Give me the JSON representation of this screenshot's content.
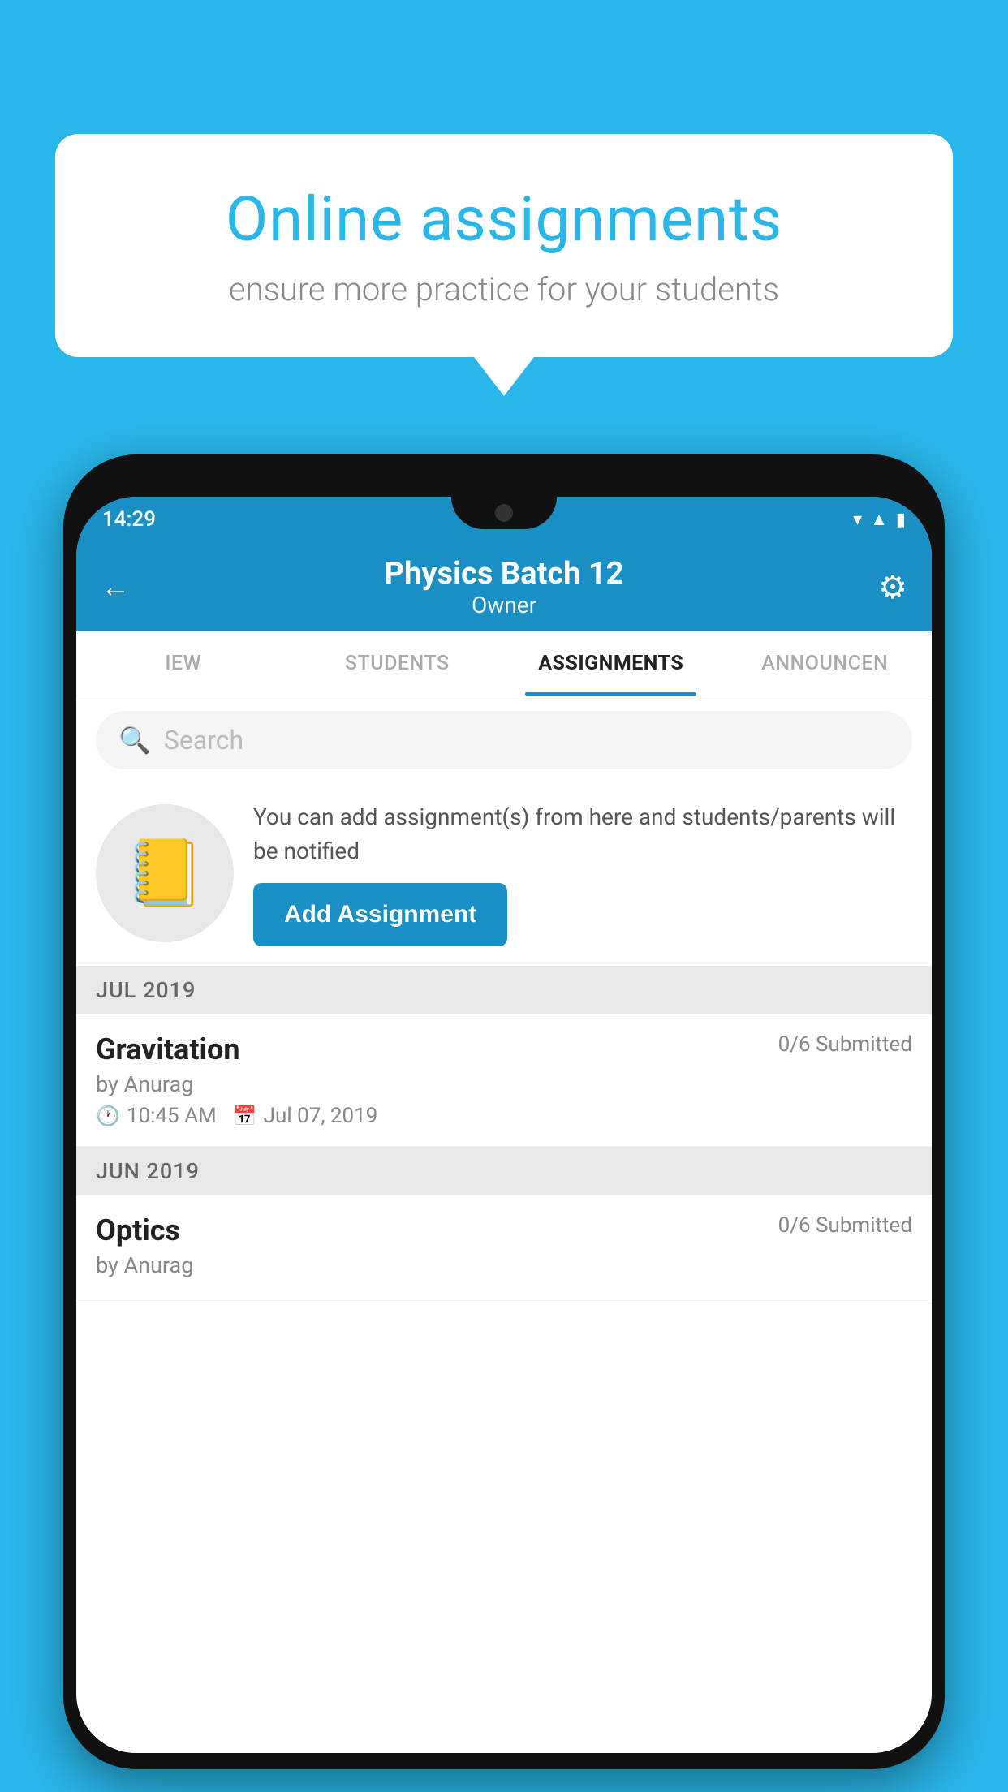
{
  "background_color": "#29b6e8",
  "speech_bubble": {
    "title": "Online assignments",
    "subtitle": "ensure more practice for your students"
  },
  "status_bar": {
    "time": "14:29",
    "icons": [
      "wifi",
      "signal",
      "battery"
    ]
  },
  "top_bar": {
    "title": "Physics Batch 12",
    "subtitle": "Owner",
    "back_label": "←",
    "gear_label": "⚙"
  },
  "tabs": [
    {
      "label": "IEW",
      "active": false
    },
    {
      "label": "STUDENTS",
      "active": false
    },
    {
      "label": "ASSIGNMENTS",
      "active": true
    },
    {
      "label": "ANNOUNCEN",
      "active": false
    }
  ],
  "search": {
    "placeholder": "Search"
  },
  "promo": {
    "text": "You can add assignment(s) from here and students/parents will be notified",
    "button_label": "Add Assignment"
  },
  "sections": [
    {
      "month": "JUL 2019",
      "assignments": [
        {
          "title": "Gravitation",
          "submitted": "0/6 Submitted",
          "author": "by Anurag",
          "time": "10:45 AM",
          "date": "Jul 07, 2019"
        }
      ]
    },
    {
      "month": "JUN 2019",
      "assignments": [
        {
          "title": "Optics",
          "submitted": "0/6 Submitted",
          "author": "by Anurag",
          "time": "",
          "date": ""
        }
      ]
    }
  ]
}
